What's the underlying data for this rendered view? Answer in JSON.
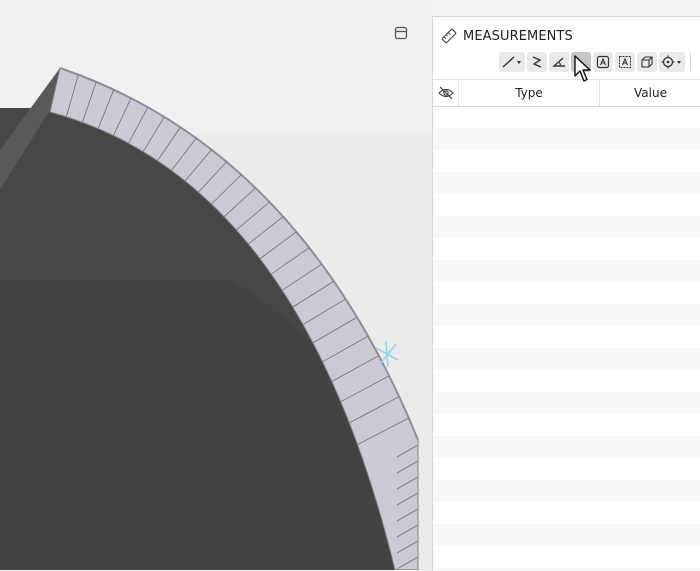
{
  "viewport": {
    "layout_button_icon": "window-layout-icon",
    "surface_color": "#444444",
    "wall_color": "#c9cad3",
    "pick_marker_color": "#8fd3f4"
  },
  "panel": {
    "title": "MEASUREMENTS",
    "title_icon": "ruler-icon",
    "toolbar": [
      {
        "icon": "line-measure-icon",
        "has_dropdown": true
      },
      {
        "icon": "polyline-measure-icon"
      },
      {
        "icon": "angle-measure-icon"
      },
      {
        "icon": "height-measure-icon",
        "active": true
      },
      {
        "icon": "area-label-icon"
      },
      {
        "icon": "area-text-icon"
      },
      {
        "icon": "volume-measure-icon"
      },
      {
        "icon": "point-target-icon",
        "has_dropdown": true
      },
      {
        "icon": "trash-icon"
      }
    ],
    "table": {
      "visibility_icon": "eye-off-icon",
      "columns": [
        "Type",
        "Value"
      ],
      "rows": []
    }
  }
}
